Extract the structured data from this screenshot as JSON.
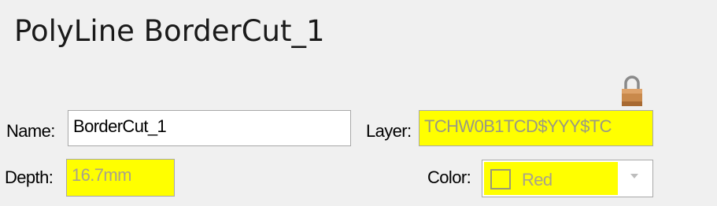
{
  "header": {
    "title": "PolyLine BorderCut_1"
  },
  "name": {
    "label": "Name:",
    "value": "BorderCut_1"
  },
  "layer": {
    "label": "Layer:",
    "value": "TCHW0B1TCD$YYY$TC",
    "locked": true,
    "lock_icon": "padlock-icon"
  },
  "depth": {
    "label": "Depth:",
    "value": "16.7mm"
  },
  "color": {
    "label": "Color:",
    "value": "Red",
    "swatch_icon": "empty-square",
    "dropdown_icon": "chevron-down-icon"
  },
  "colors": {
    "background": "#f0f0f0",
    "highlight": "#ffff00",
    "lock_body": "#c9894b",
    "lock_shackle": "#8a8a8a"
  }
}
